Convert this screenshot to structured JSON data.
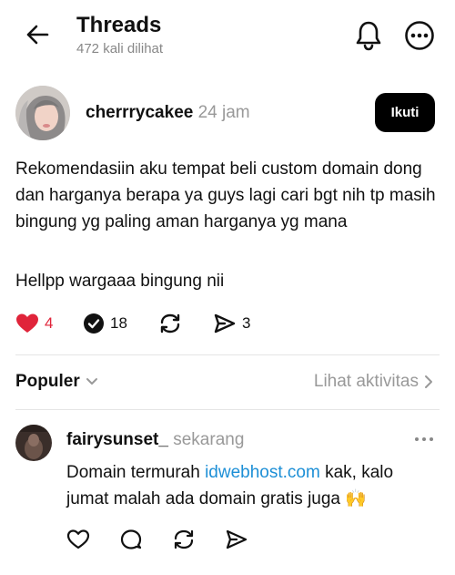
{
  "header": {
    "title": "Threads",
    "views": "472 kali dilihat"
  },
  "post": {
    "username": "cherrrycakee",
    "time": "24 jam",
    "follow_label": "Ikuti",
    "body": "Rekomendasiin aku tempat beli custom domain dong dan harganya berapa ya guys lagi cari bgt nih tp masih bingung yg paling aman harganya yg mana",
    "body2": "Hellpp wargaaa bingung nii",
    "likes": "4",
    "replies": "18",
    "shares": "3"
  },
  "sort": {
    "label": "Populer",
    "activity_link": "Lihat aktivitas"
  },
  "reply": {
    "username": "fairysunset_",
    "time": "sekarang",
    "text_before": "Domain termurah ",
    "link": "idwebhost.com",
    "text_after": " kak, kalo jumat malah ada domain gratis juga 🙌"
  },
  "colors": {
    "like_red": "#e0243a",
    "link_blue": "#1d8fd6"
  }
}
